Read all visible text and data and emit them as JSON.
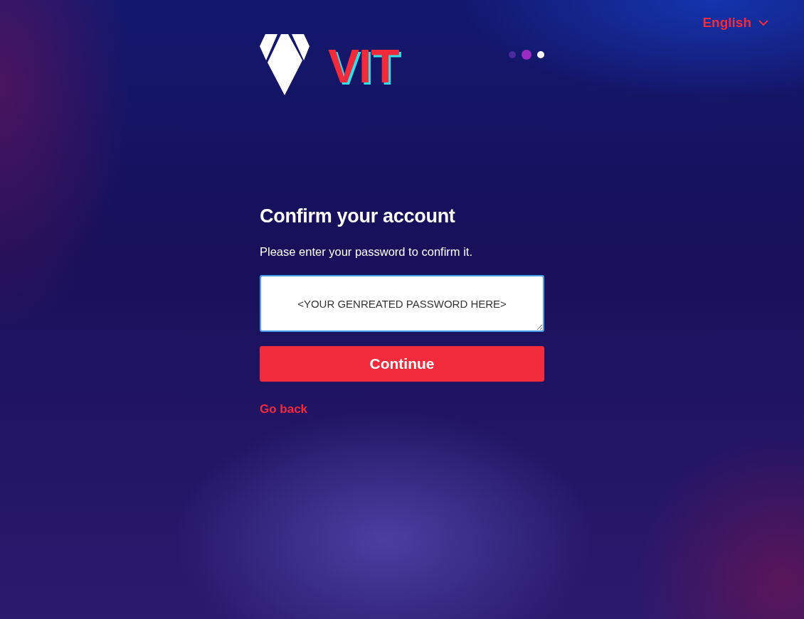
{
  "language": {
    "label": "English"
  },
  "logo": {
    "text": "VIT"
  },
  "steps": [
    {
      "selected": false,
      "color": "#4b2a9e"
    },
    {
      "selected": true,
      "color": "#9b2bc2"
    },
    {
      "selected": false,
      "color": "#ffffff"
    }
  ],
  "heading": "Confirm your account",
  "instruction": "Please enter your password to confirm it.",
  "password_field": {
    "value": "<YOUR GENREATED PASSWORD HERE>"
  },
  "continue_button": "Continue",
  "back_link": "Go back"
}
